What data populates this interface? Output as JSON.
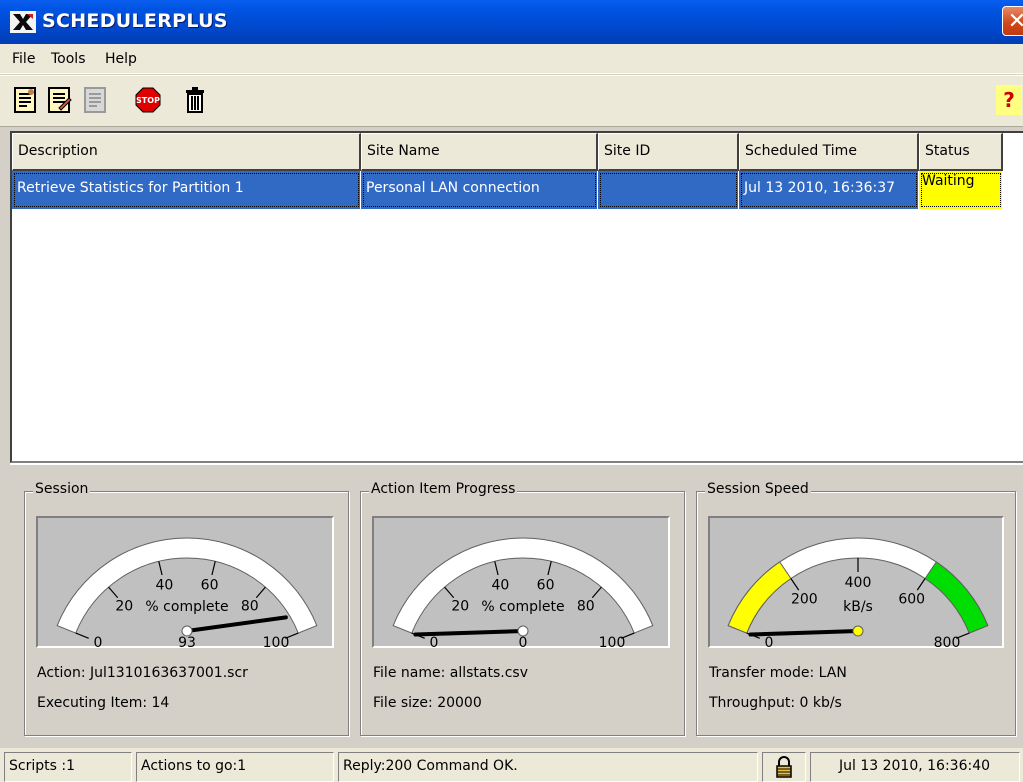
{
  "window": {
    "title": "SCHEDULERPLUS",
    "app_icon": "x-logo-icon",
    "close_label": "✕"
  },
  "menu": [
    {
      "label": "File"
    },
    {
      "label": "Tools"
    },
    {
      "label": "Help"
    }
  ],
  "toolbar": {
    "buttons": [
      {
        "name": "new-script-icon",
        "enabled": true
      },
      {
        "name": "edit-script-icon",
        "enabled": true
      },
      {
        "name": "disabled-script-icon",
        "enabled": false
      },
      {
        "name": "stop-icon",
        "enabled": true,
        "label": "STOP"
      },
      {
        "name": "trash-icon",
        "enabled": true
      }
    ],
    "help_label": "?"
  },
  "table": {
    "columns": [
      "Description",
      "Site Name",
      "Site ID",
      "Scheduled Time",
      "Status"
    ],
    "rows": [
      {
        "description": "Retrieve Statistics for Partition 1",
        "site_name": "Personal LAN connection",
        "site_id": "",
        "scheduled_time": "Jul 13 2010, 16:36:37",
        "status": "Waiting",
        "selected": true
      }
    ]
  },
  "panels": {
    "session": {
      "title": "Session",
      "gauge": {
        "unit_label": "% complete",
        "ticks": [
          "0",
          "20",
          "40",
          "60",
          "80",
          "100"
        ],
        "value": 93,
        "readout": "93",
        "min": 0,
        "max": 100
      },
      "info1": "Action:  Jul1310163637001.scr",
      "info2": "Executing Item: 14"
    },
    "action_progress": {
      "title": "Action Item Progress",
      "gauge": {
        "unit_label": "% complete",
        "ticks": [
          "0",
          "20",
          "40",
          "60",
          "80",
          "100"
        ],
        "value": 0,
        "readout": "0",
        "min": 0,
        "max": 100
      },
      "info1": "File name:  allstats.csv",
      "info2": "File size:  20000"
    },
    "session_speed": {
      "title": "Session Speed",
      "gauge": {
        "unit_label": "kB/s",
        "ticks": [
          "0",
          "200",
          "400",
          "600",
          "800"
        ],
        "value": 0,
        "readout": "",
        "min": 0,
        "max": 800,
        "zones": {
          "low": "#ffff00",
          "mid": "#ffffff",
          "high": "#00dd00"
        }
      },
      "info1": "Transfer mode:  LAN",
      "info2": "Throughput: 0 kb/s"
    }
  },
  "statusbar": {
    "scripts": "Scripts :1",
    "actions": "Actions to go:1",
    "reply": "Reply:200 Command OK.",
    "lock_icon": "lock-icon",
    "datetime": "Jul 13 2010, 16:36:40"
  },
  "colors": {
    "title_blue": "#0054e3",
    "selection": "#316ac5",
    "status_waiting": "#ffff00"
  }
}
